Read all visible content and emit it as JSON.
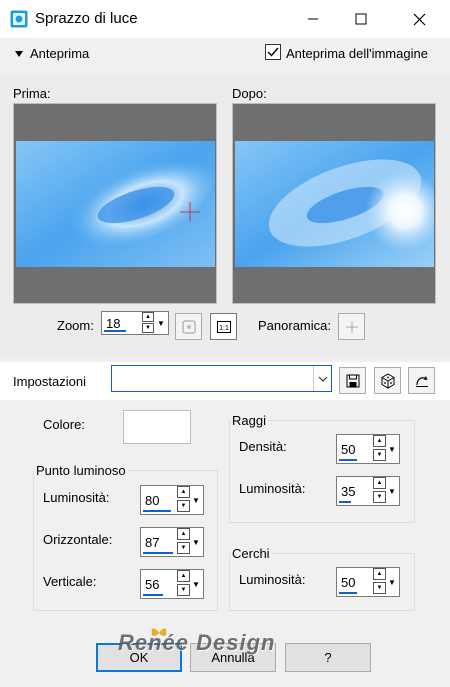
{
  "window": {
    "title": "Sprazzo di luce",
    "controls": [
      "minimize-icon",
      "maximize-icon",
      "close-icon"
    ]
  },
  "preview_toggle": {
    "label": "Anteprima",
    "checkbox_label": "Anteprima dell'immagine",
    "checkbox_checked": true
  },
  "previews": {
    "before_label": "Prima:",
    "after_label": "Dopo:"
  },
  "zoom": {
    "label": "Zoom:",
    "value": "18",
    "pan_label": "Panoramica:",
    "fit_icon": "zoom-fit-icon",
    "actual_size_icon": "actual-size-icon",
    "pan_icon": "pan-icon"
  },
  "settings": {
    "label": "Impostazioni",
    "selected": "",
    "save_icon": "save-icon",
    "random_icon": "dice-icon",
    "reset_icon": "reset-icon"
  },
  "params": {
    "colore_label": "Colore:",
    "colore_value": "#ffffff",
    "punto": {
      "legend": "Punto luminoso",
      "luminosita_label": "Luminosità:",
      "luminosita_value": "80",
      "orizzontale_label": "Orizzontale:",
      "orizzontale_value": "87",
      "verticale_label": "Verticale:",
      "verticale_value": "56"
    },
    "raggi": {
      "legend": "Raggi",
      "densita_label": "Densità:",
      "densita_value": "50",
      "luminosita_label": "Luminosità:",
      "luminosita_value": "35"
    },
    "cerchi": {
      "legend": "Cerchi",
      "luminosita_label": "Luminosità:",
      "luminosita_value": "50"
    }
  },
  "buttons": {
    "ok": "OK",
    "annulla": "Annulla",
    "help": "?"
  },
  "watermark": "Renée Design",
  "colors": {
    "accent": "#0b5fd8",
    "sky_light": "#d8ecfd",
    "sky_mid": "#5fb0f2",
    "sky_dark": "#2a86e5",
    "preview_bg": "#6f6f6f"
  }
}
